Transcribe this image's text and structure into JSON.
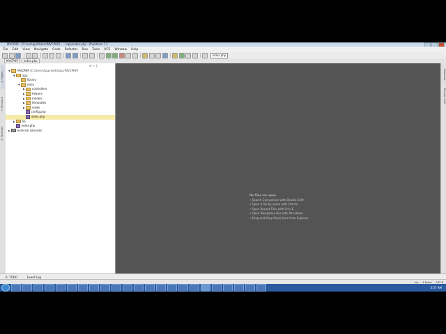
{
  "window": {
    "title": "MVCPHP - [C:\\xampp\\htdocs\\MVCPHP] - ...\\app\\index.php - PhpStorm 7.1"
  },
  "menu": [
    "File",
    "Edit",
    "View",
    "Navigate",
    "Code",
    "Refactor",
    "Run",
    "Tools",
    "VCS",
    "Window",
    "Help"
  ],
  "toolbar": {
    "run_config": "index.php"
  },
  "breadcrumb": [
    "MVCPHP",
    "index.php"
  ],
  "left_tabs": [
    "1: Project",
    "7: Structure",
    "2: Favorites"
  ],
  "right_tabs": [
    "Database",
    "Remote Host"
  ],
  "project": {
    "header": "⚙ ÷ |‹",
    "tree": [
      {
        "label": "MVCPHP",
        "path": "(C:\\Users\\Apache\\htdocs\\MVCPHP)",
        "depth": 0,
        "kind": "folder",
        "arrow": "▼"
      },
      {
        "label": "app",
        "depth": 1,
        "kind": "folder",
        "arrow": "▼"
      },
      {
        "label": "library",
        "depth": 2,
        "kind": "folder",
        "arrow": ""
      },
      {
        "label": "main",
        "depth": 2,
        "kind": "folder",
        "arrow": "▼"
      },
      {
        "label": "controllers",
        "depth": 3,
        "kind": "folder",
        "arrow": "▶"
      },
      {
        "label": "helpers",
        "depth": 3,
        "kind": "folder",
        "arrow": "▶"
      },
      {
        "label": "models",
        "depth": 3,
        "kind": "folder",
        "arrow": "▶"
      },
      {
        "label": "templates",
        "depth": 3,
        "kind": "folder",
        "arrow": "▶"
      },
      {
        "label": "views",
        "depth": 3,
        "kind": "folder",
        "arrow": "▶"
      },
      {
        "label": "config.php",
        "depth": 3,
        "kind": "file",
        "arrow": ""
      },
      {
        "label": "index.php",
        "depth": 3,
        "kind": "file",
        "arrow": "",
        "selected": true
      },
      {
        "label": "lib",
        "depth": 1,
        "kind": "folder",
        "arrow": "▶"
      },
      {
        "label": "index.php",
        "depth": 1,
        "kind": "file",
        "arrow": ""
      },
      {
        "label": "External Libraries",
        "depth": 0,
        "kind": "lib",
        "arrow": "▶"
      }
    ]
  },
  "editor_hint": {
    "heading": "No files are open",
    "lines": [
      "• Search Everywhere with Double Shift",
      "• Open a file by name with Ctrl+N",
      "• Open Recent Files with Ctrl+E",
      "• Open Navigation Bar with Alt+Home",
      "• Drag and Drop file(s) here from Explorer"
    ]
  },
  "bottom_tools": [
    "6: TODO",
    "Event Log"
  ],
  "status": {
    "position": "n/a",
    "encoding": "1 Event",
    "misc": "UTF-8"
  },
  "taskbar": {
    "clock": "3:57 AM"
  }
}
